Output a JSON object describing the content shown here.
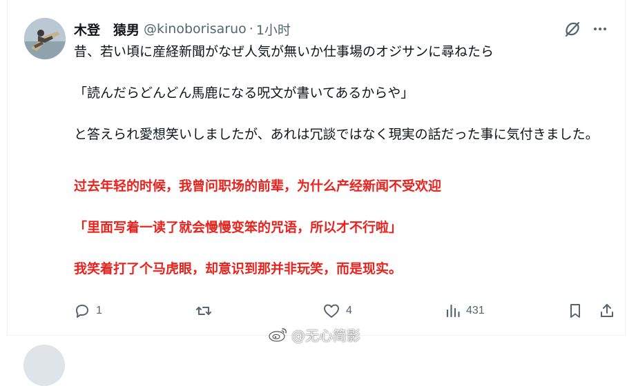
{
  "tweet": {
    "display_name": "木登　猿男",
    "handle": "@kinoborisaruo",
    "separator": "·",
    "time": "1小时",
    "paragraphs": [
      "昔、若い頃に産経新聞がなぜ人気が無いか仕事場のオジサンに尋ねたら",
      "「読んだらどんどん馬鹿になる呪文が書いてあるからや」",
      "と答えられ愛想笑いしましたが、あれは冗談ではなく現実の話だった事に気付きました。"
    ],
    "translation": [
      "过去年轻的时候，我曾问职场的前辈，为什么产经新闻不受欢迎",
      "「里面写着一读了就会慢慢变笨的咒语，所以才不行啦」",
      "我笑着打了个马虎眼，却意识到那并非玩笑，而是现实。"
    ],
    "actions": {
      "reply_count": "1",
      "retweet_count": "",
      "like_count": "4",
      "view_count": "431"
    }
  },
  "watermark": {
    "text": "@无心简影"
  },
  "colors": {
    "text": "#0f1419",
    "secondary": "#536471",
    "translation": "#e8231d",
    "border": "#eff3f4"
  },
  "icons": [
    "avatar",
    "grok-icon",
    "more-icon",
    "reply-icon",
    "retweet-icon",
    "like-icon",
    "views-icon",
    "bookmark-icon",
    "share-icon",
    "weibo-icon"
  ]
}
